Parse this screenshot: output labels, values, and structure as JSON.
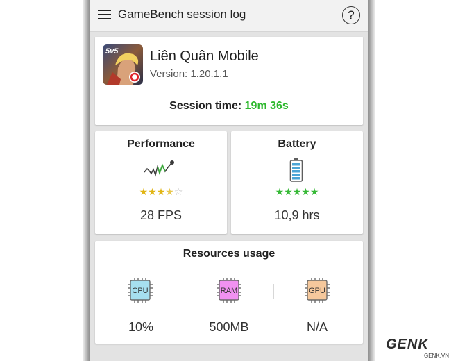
{
  "appbar": {
    "title": "GameBench session log",
    "menu_icon": "hamburger-menu-icon",
    "help_icon": "question-mark-icon",
    "help_glyph": "?"
  },
  "game": {
    "icon": "game-app-icon",
    "icon_label": "5v5",
    "title": "Liên Quân Mobile",
    "version": "Version: 1.20.1.1",
    "session_label": "Session time:",
    "session_value": "19m 36s",
    "session_value_color": "#2eb82e"
  },
  "performance": {
    "title": "Performance",
    "icon": "performance-graph-icon",
    "rating": 3.5,
    "rating_max": 5,
    "star_color": "#e1b514",
    "value": "28 FPS"
  },
  "battery": {
    "title": "Battery",
    "icon": "battery-icon",
    "rating": 5,
    "rating_max": 5,
    "star_color": "#36b936",
    "value": "10,9 hrs"
  },
  "resources": {
    "title": "Resources usage",
    "items": [
      {
        "name": "CPU",
        "icon": "cpu-chip-icon",
        "color": "#a6dff0",
        "value": "10%"
      },
      {
        "name": "RAM",
        "icon": "ram-chip-icon",
        "color": "#f191f1",
        "value": "500MB"
      },
      {
        "name": "GPU",
        "icon": "gpu-chip-icon",
        "color": "#f5c89c",
        "value": "N/A"
      }
    ]
  },
  "watermark": {
    "main": "GENK",
    "sub": "GENK.VN"
  }
}
